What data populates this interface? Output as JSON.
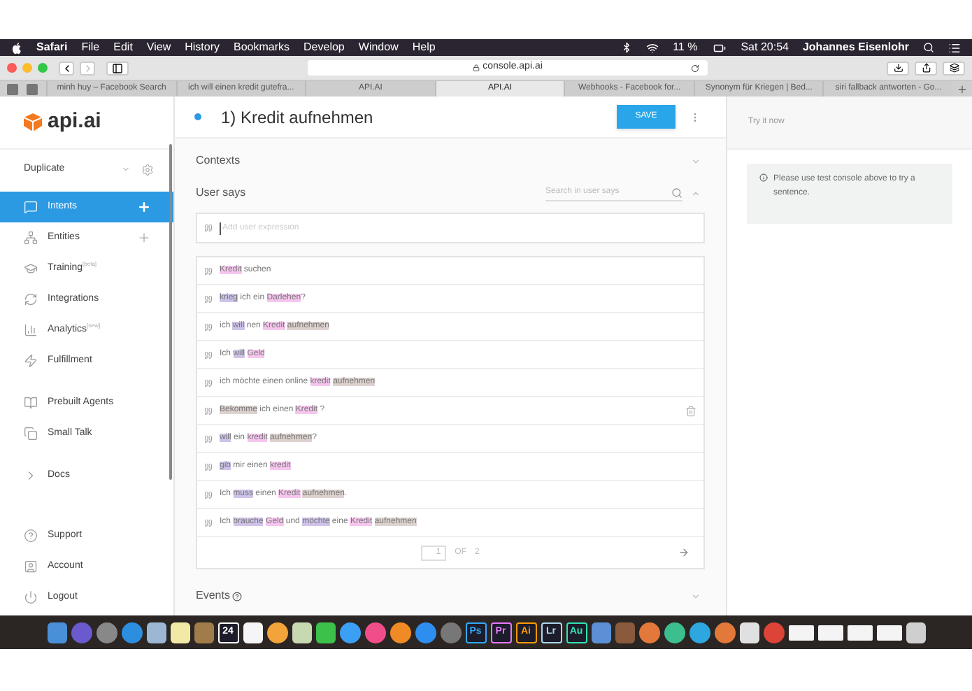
{
  "menu_bar": {
    "app": "Safari",
    "items": [
      "File",
      "Edit",
      "View",
      "History",
      "Bookmarks",
      "Develop",
      "Window",
      "Help"
    ],
    "battery": "11 %",
    "clock": "Sat 20:54",
    "user": "Johannes Eisenlohr"
  },
  "browser": {
    "address": "console.api.ai",
    "tabs": [
      {
        "label": "minh huy – Facebook Search",
        "selected": false
      },
      {
        "label": "ich will einen kredit gutefra...",
        "selected": false
      },
      {
        "label": "API.AI",
        "selected": false
      },
      {
        "label": "API.AI",
        "selected": true
      },
      {
        "label": "Webhooks - Facebook for...",
        "selected": false
      },
      {
        "label": "Synonym für Kriegen | Bed...",
        "selected": false
      },
      {
        "label": "siri fallback antworten - Go...",
        "selected": false
      }
    ]
  },
  "sidebar": {
    "logo": "api.ai",
    "agent": "Duplicate",
    "items": [
      {
        "label": "Intents",
        "selected": true,
        "add": true
      },
      {
        "label": "Entities",
        "selected": false,
        "add": true
      },
      {
        "label": "Training",
        "tag": "[beta]",
        "selected": false,
        "add": false
      },
      {
        "label": "Integrations",
        "selected": false,
        "add": false
      },
      {
        "label": "Analytics",
        "tag": "[new]",
        "selected": false,
        "add": false
      },
      {
        "label": "Fulfillment",
        "selected": false,
        "add": false
      },
      {
        "label": "Prebuilt Agents",
        "selected": false,
        "add": false
      },
      {
        "label": "Small Talk",
        "selected": false,
        "add": false
      },
      {
        "label": "Docs",
        "selected": false,
        "add": false
      }
    ],
    "footer": [
      {
        "label": "Support"
      },
      {
        "label": "Account"
      },
      {
        "label": "Logout"
      }
    ]
  },
  "intent": {
    "title": "1) Kredit aufnehmen",
    "save": "SAVE",
    "contexts": "Contexts",
    "user_says": "User says",
    "search_placeholder": "Search in user says",
    "add_placeholder": "Add user expression",
    "expressions": [
      {
        "parts": [
          {
            "text": "Kredit",
            "color": "#f7c6ef"
          },
          {
            "text": " suchen"
          }
        ]
      },
      {
        "parts": [
          {
            "text": "krieg",
            "color": "#cfc3ea"
          },
          {
            "text": " ich ein "
          },
          {
            "text": "Darlehen",
            "color": "#f7c6ef"
          },
          {
            "text": "?"
          }
        ]
      },
      {
        "parts": [
          {
            "text": "ich "
          },
          {
            "text": "will",
            "color": "#cfc3ea"
          },
          {
            "text": " nen "
          },
          {
            "text": "Kredit",
            "color": "#f7c6ef"
          },
          {
            "text": "aufnehmen",
            "color": "#ddd2cf"
          }
        ]
      },
      {
        "parts": [
          {
            "text": "Ich "
          },
          {
            "text": "will",
            "color": "#cfc3ea"
          },
          {
            "text": "Geld",
            "color": "#f7c6ef"
          }
        ]
      },
      {
        "parts": [
          {
            "text": "ich möchte einen online "
          },
          {
            "text": "kredit",
            "color": "#f7c6ef"
          },
          {
            "text": "aufnehmen",
            "color": "#ddd2cf"
          }
        ]
      },
      {
        "parts": [
          {
            "text": "Bekomme",
            "color": "#ddd2cf"
          },
          {
            "text": " ich einen "
          },
          {
            "text": "Kredit",
            "color": "#f7c6ef"
          },
          {
            "text": " ?"
          }
        ],
        "hovered": true
      },
      {
        "parts": [
          {
            "text": "will",
            "color": "#cfc3ea"
          },
          {
            "text": " ein "
          },
          {
            "text": "kredit",
            "color": "#f7c6ef"
          },
          {
            "text": "aufnehmen",
            "color": "#ddd2cf"
          },
          {
            "text": "?"
          }
        ]
      },
      {
        "parts": [
          {
            "text": "gib",
            "color": "#cfc3ea"
          },
          {
            "text": " mir einen "
          },
          {
            "text": "kredit",
            "color": "#f7c6ef"
          }
        ]
      },
      {
        "parts": [
          {
            "text": "Ich "
          },
          {
            "text": "muss",
            "color": "#cfc3ea"
          },
          {
            "text": " einen "
          },
          {
            "text": "Kredit",
            "color": "#f7c6ef"
          },
          {
            "text": "aufnehmen",
            "color": "#ddd2cf"
          },
          {
            "text": "."
          }
        ]
      },
      {
        "parts": [
          {
            "text": "Ich "
          },
          {
            "text": "brauche",
            "color": "#cfc3ea"
          },
          {
            "text": "Geld",
            "color": "#f7c6ef"
          },
          {
            "text": " und "
          },
          {
            "text": "möchte",
            "color": "#cfc3ea"
          },
          {
            "text": " eine "
          },
          {
            "text": "Kredit",
            "color": "#f7c6ef"
          },
          {
            "text": "aufnehmen",
            "color": "#ddd2cf"
          }
        ]
      }
    ],
    "page": "1",
    "of": "OF",
    "pages": "2",
    "events": "Events"
  },
  "test_panel": {
    "title": "Try it now",
    "message": "Please use test console above to try a sentence."
  },
  "dock": [
    {
      "kind": "app",
      "color": "#4a90d9"
    },
    {
      "kind": "round",
      "color": "#6a5acd"
    },
    {
      "kind": "round",
      "color": "#888888"
    },
    {
      "kind": "round",
      "color": "#2d8ee0"
    },
    {
      "kind": "app",
      "color": "#9bb7d4"
    },
    {
      "kind": "app",
      "color": "#f3e9a6"
    },
    {
      "kind": "app",
      "color": "#a07c4a"
    },
    {
      "kind": "tile",
      "label": "24",
      "color": "#ffffff"
    },
    {
      "kind": "app",
      "color": "#f5f5f5"
    },
    {
      "kind": "round",
      "color": "#f2a33a"
    },
    {
      "kind": "app",
      "color": "#c6d9b0"
    },
    {
      "kind": "app",
      "color": "#3cc14a"
    },
    {
      "kind": "round",
      "color": "#3ba0f5"
    },
    {
      "kind": "round",
      "color": "#f04e8a"
    },
    {
      "kind": "round",
      "color": "#f08a24"
    },
    {
      "kind": "round",
      "color": "#2d8ef0"
    },
    {
      "kind": "round",
      "color": "#777777"
    },
    {
      "kind": "tile",
      "label": "Ps",
      "color": "#31a8ff"
    },
    {
      "kind": "tile",
      "label": "Pr",
      "color": "#ea77ff"
    },
    {
      "kind": "tile",
      "label": "Ai",
      "color": "#ff9a00"
    },
    {
      "kind": "tile",
      "label": "Lr",
      "color": "#add5ec"
    },
    {
      "kind": "tile",
      "label": "Au",
      "color": "#2fe3b5"
    },
    {
      "kind": "app",
      "color": "#5b8fd6"
    },
    {
      "kind": "app",
      "color": "#8a5a3c"
    },
    {
      "kind": "round",
      "color": "#e2793a"
    },
    {
      "kind": "round",
      "color": "#3bbf8f"
    },
    {
      "kind": "round",
      "color": "#2ea6df"
    },
    {
      "kind": "round",
      "color": "#e2793a"
    },
    {
      "kind": "app",
      "color": "#e0e0e0"
    },
    {
      "kind": "round",
      "color": "#db4437"
    },
    {
      "kind": "doc",
      "color": "#f4f4f4"
    },
    {
      "kind": "doc",
      "color": "#f4f4f4"
    },
    {
      "kind": "doc",
      "color": "#f4f4f4"
    },
    {
      "kind": "doc",
      "color": "#f4f4f4"
    },
    {
      "kind": "app",
      "color": "#cfcfcf"
    }
  ]
}
